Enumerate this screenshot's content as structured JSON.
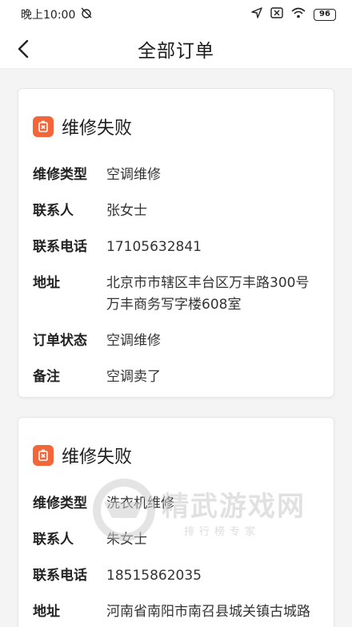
{
  "status_bar": {
    "time": "晚上10:00",
    "battery": "96"
  },
  "header": {
    "title": "全部订单"
  },
  "orders": [
    {
      "status": "维修失败",
      "fields": [
        {
          "label": "维修类型",
          "value": "空调维修"
        },
        {
          "label": "联系人",
          "value": "张女士"
        },
        {
          "label": "联系电话",
          "value": "17105632841"
        },
        {
          "label": "地址",
          "value": "北京市市辖区丰台区万丰路300号万丰商务写字楼608室"
        },
        {
          "label": "订单状态",
          "value": "空调维修"
        },
        {
          "label": "备注",
          "value": "空调卖了"
        }
      ]
    },
    {
      "status": "维修失败",
      "fields": [
        {
          "label": "维修类型",
          "value": "洗衣机维修"
        },
        {
          "label": "联系人",
          "value": "朱女士"
        },
        {
          "label": "联系电话",
          "value": "18515862035"
        },
        {
          "label": "地址",
          "value": "河南省南阳市南召县城关镇古城路"
        }
      ]
    }
  ],
  "watermark": {
    "title": "精武游戏网",
    "subtitle": "排行榜专家"
  },
  "colors": {
    "accent": "#f2663a",
    "background": "#f4f4f4",
    "card": "#ffffff"
  }
}
